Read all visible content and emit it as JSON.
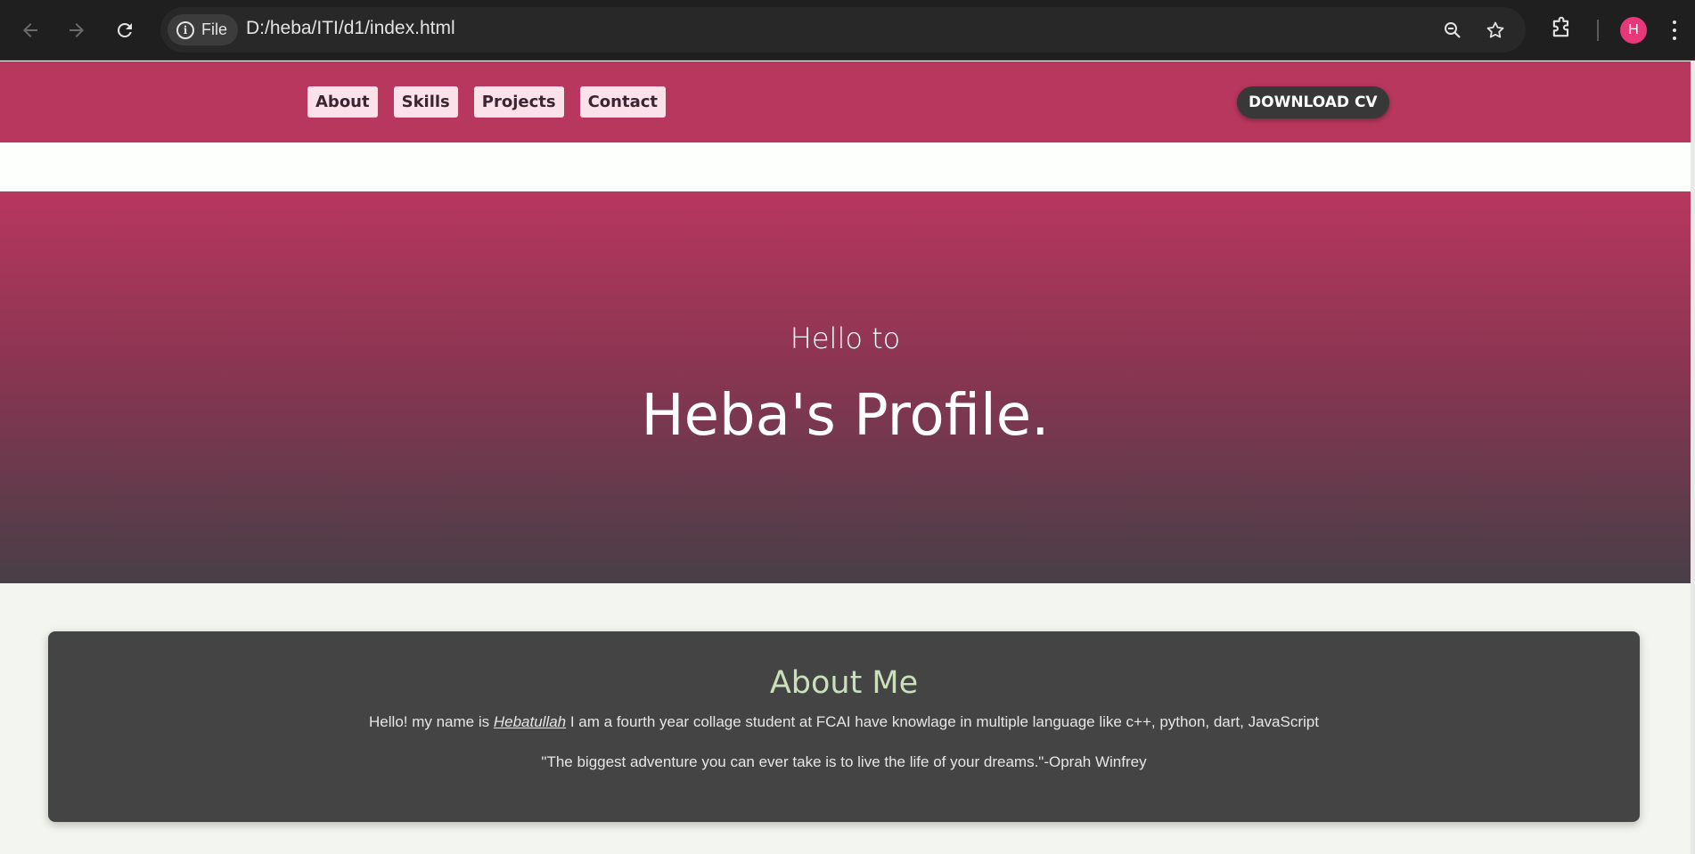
{
  "browser": {
    "file_chip_label": "File",
    "url": "D:/heba/ITI/d1/index.html",
    "avatar_letter": "H",
    "icons": [
      "back-icon",
      "forward-icon",
      "reload-icon",
      "info-icon",
      "zoom-icon",
      "star-icon",
      "extensions-icon",
      "menu-icon"
    ]
  },
  "nav": {
    "links": [
      "About",
      "Skills",
      "Projects",
      "Contact"
    ],
    "cv_button": "DOWNLOAD CV"
  },
  "hero": {
    "greeting": "Hello to",
    "title": "Heba's Profile."
  },
  "about": {
    "heading": "About Me",
    "bio_prefix": "Hello! my name is ",
    "bio_name": "Hebatullah",
    "bio_suffix": " I am a fourth year collage student at FCAI have knowlage in multiple language like c++, python, dart, JavaScript",
    "quote": "\"The biggest adventure you can ever take is to live the life of your dreams.\"-Oprah Winfrey"
  },
  "colors": {
    "brand": "#b8375f",
    "hero_bottom": "#483f46",
    "about_bg": "#444444",
    "about_heading": "#c9e0b9",
    "avatar": "#e8387a"
  }
}
